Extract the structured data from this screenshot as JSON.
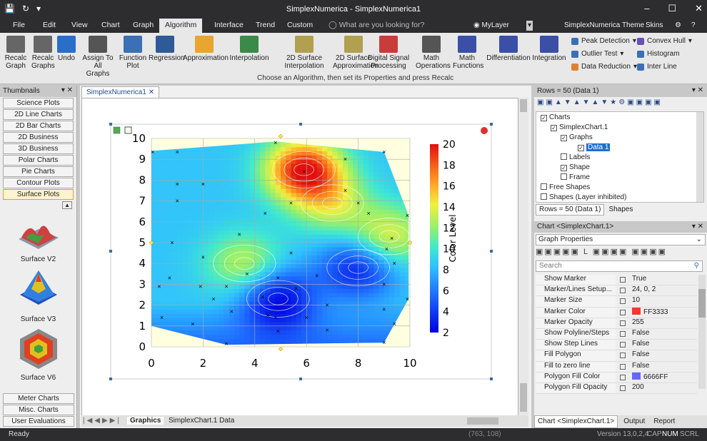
{
  "app": {
    "title": "SimplexNumerica - SimplexNumerica1",
    "layer": "MyLayer",
    "theme": "SimplexNumerica Theme",
    "skins": "Skins"
  },
  "menu": [
    "File",
    "Edit",
    "View",
    "Chart",
    "Graph",
    "Algorithm",
    "Interface",
    "Trend",
    "Custom"
  ],
  "search_placeholder": "What are you looking for?",
  "ribbon": {
    "buttons": [
      {
        "l1": "Recalc",
        "l2": "Graph",
        "icon": "recalc-graph-icon",
        "color": "#666"
      },
      {
        "l1": "Recalc",
        "l2": "Graphs",
        "icon": "recalc-graphs-icon",
        "color": "#666"
      },
      {
        "l1": "Undo",
        "l2": "",
        "icon": "undo-icon",
        "color": "#2a6ec8"
      },
      {
        "l1": "Assign To",
        "l2": "All Graphs",
        "icon": "assign-icon",
        "color": "#555"
      },
      {
        "l1": "Function",
        "l2": "Plot",
        "icon": "function-plot-icon",
        "color": "#3b6fb6"
      },
      {
        "l1": "Regression",
        "l2": "",
        "icon": "regression-icon",
        "color": "#2f5a9a"
      },
      {
        "l1": "Approximation",
        "l2": "",
        "icon": "approximation-icon",
        "color": "#e8a530"
      },
      {
        "l1": "Interpolation",
        "l2": "",
        "icon": "interpolation-icon",
        "color": "#3a8a4a"
      },
      {
        "l1": "2D Surface",
        "l2": "Interpolation",
        "icon": "surface-interp-icon",
        "color": "#b0a050"
      },
      {
        "l1": "2D Surface",
        "l2": "Approximation",
        "icon": "surface-approx-icon",
        "color": "#b0a050"
      },
      {
        "l1": "Digital Signal",
        "l2": "Processing",
        "icon": "dsp-icon",
        "color": "#c83c3c"
      },
      {
        "l1": "Math",
        "l2": "Operations",
        "icon": "math-ops-icon",
        "color": "#555"
      },
      {
        "l1": "Math",
        "l2": "Functions",
        "icon": "math-functions-icon",
        "color": "#3b4fa6"
      },
      {
        "l1": "Differentiation",
        "l2": "",
        "icon": "differentiation-icon",
        "color": "#3b4fa6"
      },
      {
        "l1": "Integration",
        "l2": "",
        "icon": "integration-icon",
        "color": "#3b4fa6"
      }
    ],
    "small": [
      "Peak Detection",
      "Outlier Test",
      "Data Reduction",
      "Convex Hull",
      "Histogram",
      "Inter Line"
    ],
    "hint": "Choose an Algorithm, then set its Properties and press Recalc"
  },
  "thumbnails": {
    "title": "Thumbnails",
    "categories": [
      "Science Plots",
      "2D Line Charts",
      "2D Bar Charts",
      "2D Business",
      "3D Business",
      "Polar Charts",
      "Pie Charts",
      "Contour Plots",
      "Surface Plots"
    ],
    "items": [
      "Surface V2",
      "Surface V3",
      "Surface V6"
    ],
    "bottom": [
      "Meter Charts",
      "Misc. Charts",
      "User Evaluations"
    ]
  },
  "document": {
    "tab": "SimplexNumerica1",
    "sheets": [
      "Graphics",
      "SimplexChart.1 Data"
    ]
  },
  "chart_data": {
    "type": "heatmap",
    "xlabel": "",
    "ylabel": "",
    "colorbar_label": "Color Level",
    "xlim": [
      0,
      10
    ],
    "ylim": [
      0,
      10
    ],
    "xticks": [
      0,
      2,
      4,
      6,
      8,
      10
    ],
    "yticks": [
      0,
      1,
      2,
      3,
      4,
      5,
      6,
      7,
      8,
      9,
      10
    ],
    "cticks": [
      2,
      4,
      6,
      8,
      10,
      12,
      14,
      16,
      18,
      20
    ],
    "clim": [
      2,
      20
    ],
    "hotspots": [
      {
        "x": 5.9,
        "y": 8.5,
        "v": 20
      },
      {
        "x": 9.2,
        "y": 5.3,
        "v": 14
      },
      {
        "x": 3.6,
        "y": 4.0,
        "v": 13
      },
      {
        "x": 8.0,
        "y": 3.8,
        "v": 3
      },
      {
        "x": 4.9,
        "y": 2.3,
        "v": 2
      },
      {
        "x": 7.0,
        "y": 6.9,
        "v": 13
      }
    ],
    "points": [
      [
        0.05,
        9.35
      ],
      [
        1,
        9.35
      ],
      [
        4.8,
        9.8
      ],
      [
        7.5,
        9.0
      ],
      [
        9,
        9.35
      ],
      [
        5.9,
        8.4
      ],
      [
        1,
        7.8
      ],
      [
        2,
        7.8
      ],
      [
        7.5,
        7.5
      ],
      [
        1,
        7.0
      ],
      [
        5.4,
        6.9
      ],
      [
        4.4,
        6.4
      ],
      [
        8,
        6.9
      ],
      [
        8.4,
        6.4
      ],
      [
        9.9,
        6.3
      ],
      [
        3.4,
        5.4
      ],
      [
        9.3,
        5.2
      ],
      [
        0.8,
        5.0
      ],
      [
        9.1,
        4.7
      ],
      [
        5.4,
        4.5
      ],
      [
        2,
        4.3
      ],
      [
        3.7,
        3.5
      ],
      [
        9.4,
        4.0
      ],
      [
        0.7,
        3.3
      ],
      [
        4.9,
        3.3
      ],
      [
        6.4,
        3.4
      ],
      [
        0.3,
        2.9
      ],
      [
        1.9,
        2.9
      ],
      [
        2.9,
        2.9
      ],
      [
        9,
        3.0
      ],
      [
        5.6,
        2.8
      ],
      [
        4.3,
        2.4
      ],
      [
        2.4,
        2.3
      ],
      [
        9.9,
        2.3
      ],
      [
        6.8,
        2.0
      ],
      [
        9,
        1.8
      ],
      [
        3.1,
        1.7
      ],
      [
        4.5,
        1.5
      ],
      [
        4.8,
        1.4
      ],
      [
        0.4,
        1.4
      ],
      [
        6,
        1.4
      ],
      [
        1.6,
        1.1
      ],
      [
        9.4,
        1.1
      ],
      [
        4.9,
        0.75
      ],
      [
        6.8,
        0.8
      ],
      [
        9,
        0.2
      ],
      [
        2.9,
        0.15
      ]
    ]
  },
  "layers": {
    "header": "Rows = 50 (Data 1)",
    "tree": [
      "Charts",
      "SimplexChart.1",
      "Graphs",
      "Data 1",
      "Labels",
      "Shape",
      "Frame",
      "Free Shapes",
      "Shapes (Layer inhibited)"
    ],
    "tabs": [
      "Rows = 50 (Data 1)",
      "Shapes"
    ]
  },
  "properties": {
    "title": "Chart <SimplexChart.1>",
    "graph_props": "Graph Properties",
    "search": "Search",
    "rows": [
      {
        "k": "Show Marker",
        "v": "True"
      },
      {
        "k": "Marker/Lines Setup...",
        "v": "24, 0, 2"
      },
      {
        "k": "Marker Size",
        "v": "10"
      },
      {
        "k": "Marker Color",
        "v": "FF3333",
        "sw": "#ff3333"
      },
      {
        "k": "Marker Opacity",
        "v": "255"
      },
      {
        "k": "Show Polyline/Steps",
        "v": "False"
      },
      {
        "k": "Show Step Lines",
        "v": "False"
      },
      {
        "k": "Fill Polygon",
        "v": "False"
      },
      {
        "k": "Fill to zero line",
        "v": "False"
      },
      {
        "k": "Polygon Fill Color",
        "v": "6666FF",
        "sw": "#6666ff"
      },
      {
        "k": "Polygon Fill Opacity",
        "v": "200"
      }
    ],
    "tabs": [
      "Chart <SimplexChart.1>",
      "Output",
      "Report"
    ]
  },
  "status": {
    "left": "Ready",
    "coords": "(763, 108)",
    "version": "Version 13,0,2,4",
    "cap": "CAP",
    "num": "NUM",
    "scrl": "SCRL"
  }
}
